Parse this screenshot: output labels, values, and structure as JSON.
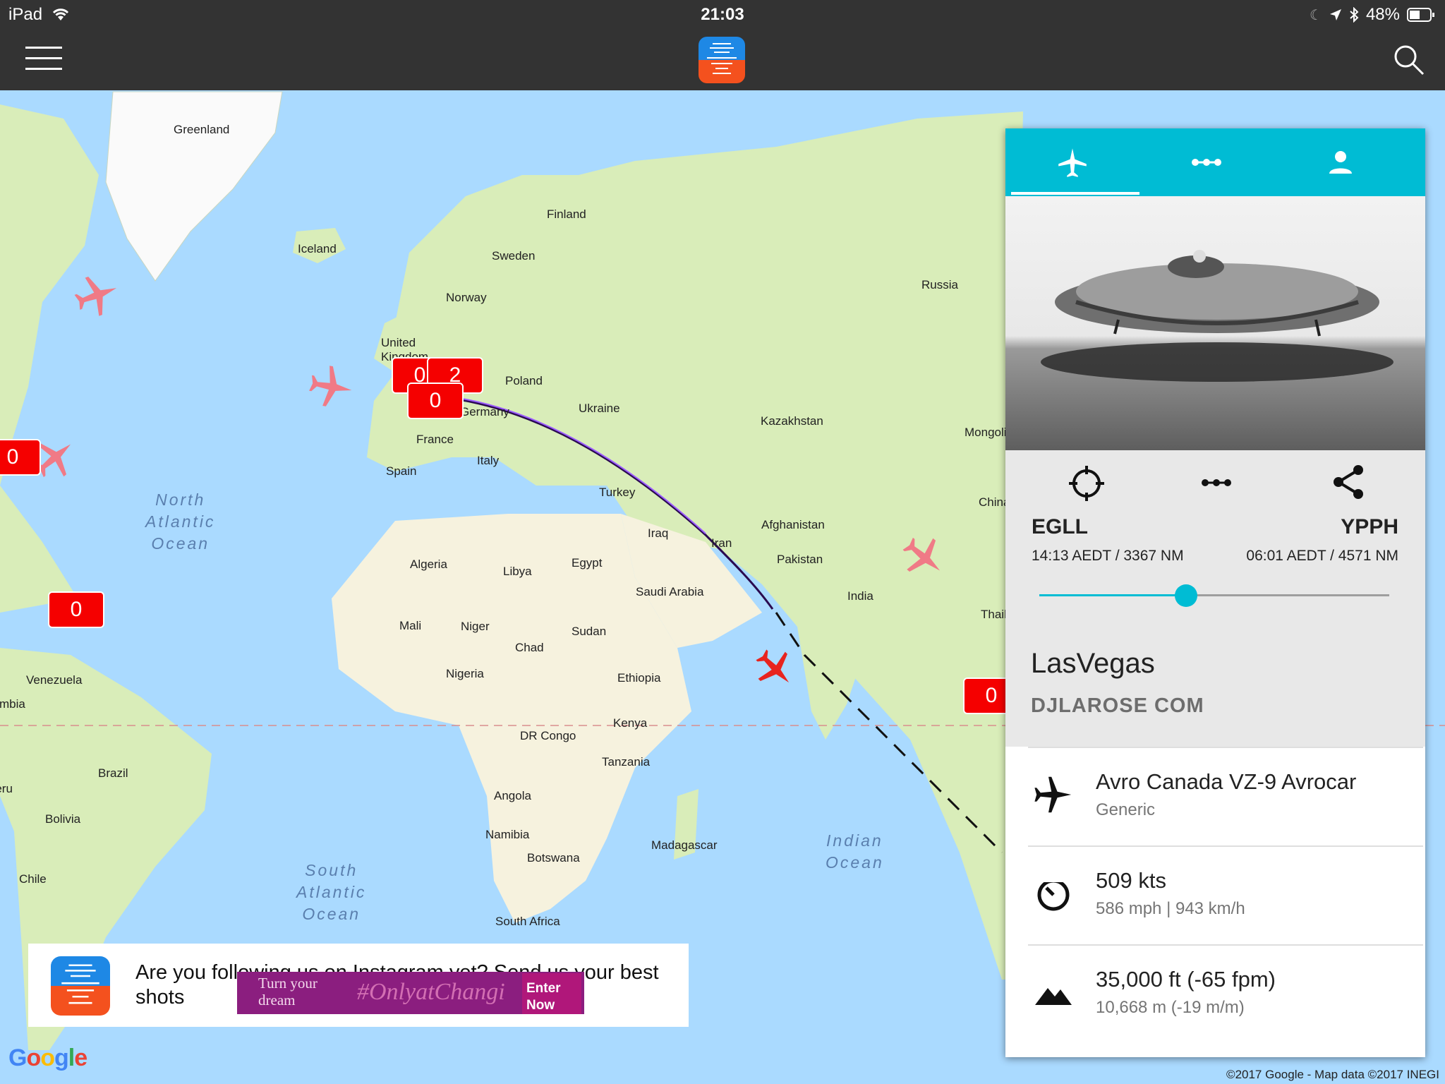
{
  "status_bar": {
    "device": "iPad",
    "time": "21:03",
    "battery": "48%"
  },
  "map": {
    "countries": [
      {
        "name": "Greenland"
      },
      {
        "name": "Iceland"
      },
      {
        "name": "Finland"
      },
      {
        "name": "Sweden"
      },
      {
        "name": "Norway"
      },
      {
        "name": "Russia"
      },
      {
        "name": "United Kingdom"
      },
      {
        "name": "Poland"
      },
      {
        "name": "Ukraine"
      },
      {
        "name": "Germany"
      },
      {
        "name": "Kazakhstan"
      },
      {
        "name": "France"
      },
      {
        "name": "Italy"
      },
      {
        "name": "Spain"
      },
      {
        "name": "Turkey"
      },
      {
        "name": "Mongolia"
      },
      {
        "name": "China"
      },
      {
        "name": "Algeria"
      },
      {
        "name": "Libya"
      },
      {
        "name": "Egypt"
      },
      {
        "name": "Iraq"
      },
      {
        "name": "Iran"
      },
      {
        "name": "Afghanistan"
      },
      {
        "name": "Pakistan"
      },
      {
        "name": "Saudi Arabia"
      },
      {
        "name": "India"
      },
      {
        "name": "Thailand"
      },
      {
        "name": "Mali"
      },
      {
        "name": "Niger"
      },
      {
        "name": "Chad"
      },
      {
        "name": "Sudan"
      },
      {
        "name": "Nigeria"
      },
      {
        "name": "Ethiopia"
      },
      {
        "name": "Venezuela"
      },
      {
        "name": "Colombia"
      },
      {
        "name": "Kenya"
      },
      {
        "name": "DR Congo"
      },
      {
        "name": "Tanzania"
      },
      {
        "name": "Brazil"
      },
      {
        "name": "Peru"
      },
      {
        "name": "Angola"
      },
      {
        "name": "Bolivia"
      },
      {
        "name": "Namibia"
      },
      {
        "name": "Botswana"
      },
      {
        "name": "Madagascar"
      },
      {
        "name": "Chile"
      },
      {
        "name": "South Africa"
      }
    ],
    "oceans": [
      {
        "name": "North\nAtlantic\nOcean"
      },
      {
        "name": "South\nAtlantic\nOcean"
      },
      {
        "name": "Indian\nOcean"
      }
    ],
    "badges": [
      "0",
      "2",
      "0",
      "0",
      "0",
      "0"
    ],
    "copyright": "©2017 Google - Map data ©2017 INEGI",
    "google_logo": "Google"
  },
  "panel": {
    "route": {
      "origin": "EGLL",
      "destination": "YPPH",
      "origin_meta": "14:13 AEDT / 3367 NM",
      "destination_meta": "06:01 AEDT / 4571 NM",
      "progress": 0.42
    },
    "callsign": "LasVegas",
    "airline": "DJLAROSE COM",
    "aircraft": {
      "name": "Avro Canada VZ-9 Avrocar",
      "type": "Generic"
    },
    "speed": {
      "main": "509 kts",
      "sub": "586 mph | 943 km/h"
    },
    "altitude": {
      "main": "35,000 ft (-65 fpm)",
      "sub": "10,668 m (-19 m/m)"
    }
  },
  "ad": {
    "text": "Are you following us on Instagram yet? Send us your best shots",
    "banner_left": "Turn your dream",
    "banner_tag": "#OnlyatChangi",
    "banner_cta": "Enter Now"
  },
  "colors": {
    "accent": "#00bcd4",
    "badge": "#f50000",
    "toolbar": "#333333",
    "water": "#aadaff",
    "land": "#d9edb9"
  }
}
